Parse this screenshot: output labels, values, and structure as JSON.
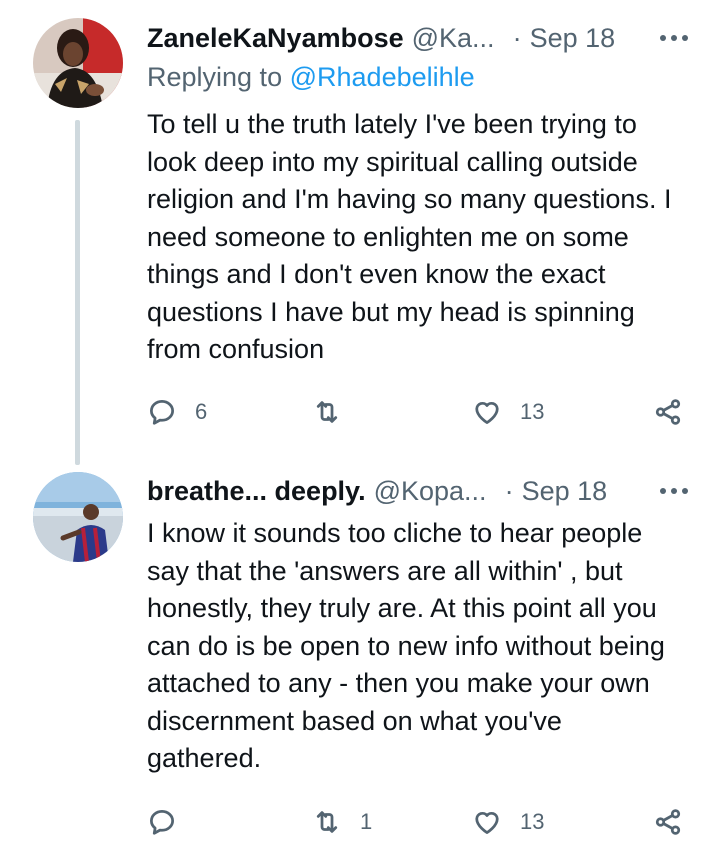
{
  "tweets": [
    {
      "display_name": "ZaneleKaNyambose",
      "handle": "@Ka...",
      "separator": "·",
      "date": "Sep 18",
      "replying_prefix": "Replying to",
      "replying_to": "@Rhadebelihle",
      "text": "To tell u the truth lately I've been trying to\nlook deep into my spiritual calling outside\nreligion and I'm having so many questions. I\nneed someone to enlighten me on some\nthings and I don't even know the exact\nquestions I have but my head is spinning\nfrom confusion",
      "replies": "6",
      "retweets": "",
      "likes": "13"
    },
    {
      "display_name": "breathe... deeply.",
      "handle": "@Kopa...",
      "separator": "·",
      "date": "Sep 18",
      "text": "I know it sounds too cliche to hear people\nsay that the 'answers are all within' , but\nhonestly, they truly are. At this point all you\ncan do is be open to new info without being\nattached to any - then you make your own\ndiscernment based on what you've\ngathered.",
      "replies": "",
      "retweets": "1",
      "likes": "13"
    }
  ],
  "icons": {
    "reply": "reply-icon",
    "retweet": "retweet-icon",
    "like": "heart-icon",
    "share": "share-icon",
    "more": "more-icon"
  },
  "colors": {
    "text": "#0f1419",
    "secondary": "#536471",
    "link": "#1d9bf0",
    "thread_line": "#cfd9de"
  }
}
